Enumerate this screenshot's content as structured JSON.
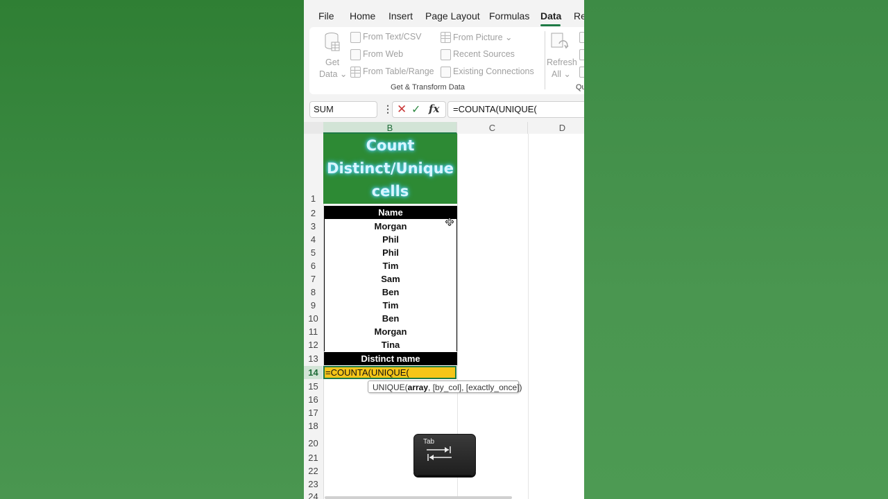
{
  "ribbon": {
    "tabs": [
      {
        "label": "File"
      },
      {
        "label": "Home"
      },
      {
        "label": "Insert"
      },
      {
        "label": "Page Layout"
      },
      {
        "label": "Formulas"
      },
      {
        "label": "Data"
      },
      {
        "label": "Re"
      }
    ],
    "active_tab": "Data",
    "get_data": {
      "line1": "Get",
      "line2": "Data ⌄"
    },
    "items": [
      {
        "label": "From Text/CSV"
      },
      {
        "label": "From Web"
      },
      {
        "label": "From Table/Range"
      },
      {
        "label": "From Picture ⌄"
      },
      {
        "label": "Recent Sources"
      },
      {
        "label": "Existing Connections"
      }
    ],
    "group_label": "Get & Transform Data",
    "refresh": {
      "line1": "Refresh",
      "line2": "All ⌄"
    },
    "next_group_label": "Qu"
  },
  "formula_bar": {
    "name_box": "SUM",
    "formula": "=COUNTA(UNIQUE("
  },
  "columns": [
    "B",
    "C",
    "D"
  ],
  "rows": [
    "1",
    "2",
    "3",
    "4",
    "5",
    "6",
    "7",
    "8",
    "9",
    "10",
    "11",
    "12",
    "13",
    "14",
    "15",
    "16",
    "17",
    "18",
    "20",
    "21",
    "22",
    "23",
    "24"
  ],
  "sheet": {
    "title_lines": [
      "Count",
      "Distinct/Unique",
      "cells"
    ],
    "header": "Name",
    "names": [
      "Morgan",
      "Phil",
      "Phil",
      "Tim",
      "Sam",
      "Ben",
      "Tim",
      "Ben",
      "Morgan",
      "Tina"
    ],
    "distinct_header": "Distinct name",
    "active_cell_text": "=COUNTA(UNIQUE(",
    "tooltip": {
      "fn": "UNIQUE(",
      "arg1": "array",
      "rest": ", [by_col], [exactly_once])"
    }
  },
  "overlay": {
    "key_label": "Tab"
  },
  "colors": {
    "accent": "#1e7a45",
    "title_bg": "#2d8a34",
    "active_cell": "#f5c518"
  }
}
